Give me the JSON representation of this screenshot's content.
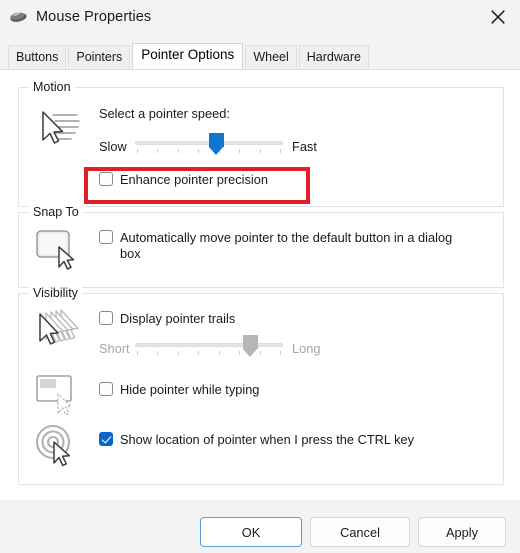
{
  "window": {
    "title": "Mouse Properties",
    "icon": "mouse-icon",
    "close_label": "close-icon"
  },
  "tabs": [
    {
      "label": "Buttons",
      "selected": false
    },
    {
      "label": "Pointers",
      "selected": false
    },
    {
      "label": "Pointer Options",
      "selected": true
    },
    {
      "label": "Wheel",
      "selected": false
    },
    {
      "label": "Hardware",
      "selected": false
    }
  ],
  "groups": {
    "motion": {
      "label": "Motion",
      "icon": "pointer-speed-icon",
      "speed_prompt": "Select a pointer speed:",
      "slider": {
        "min_label": "Slow",
        "max_label": "Fast",
        "value_percent": 55,
        "enabled": true
      },
      "enhance_precision": {
        "label": "Enhance pointer precision",
        "checked": false,
        "highlighted": true
      }
    },
    "snap_to": {
      "label": "Snap To",
      "icon": "default-button-cursor-icon",
      "auto_move": {
        "label": "Automatically move pointer to the default button in a dialog box",
        "checked": false
      }
    },
    "visibility": {
      "label": "Visibility",
      "pointer_trails": {
        "icon": "pointer-trails-icon",
        "label": "Display pointer trails",
        "checked": false,
        "slider": {
          "min_label": "Short",
          "max_label": "Long",
          "value_percent": 78,
          "enabled": false
        }
      },
      "hide_while_typing": {
        "icon": "hide-pointer-typing-icon",
        "label": "Hide pointer while typing",
        "checked": false
      },
      "show_location": {
        "icon": "ctrl-locate-pointer-icon",
        "label": "Show location of pointer when I press the CTRL key",
        "checked": true
      }
    }
  },
  "footer": {
    "ok": "OK",
    "cancel": "Cancel",
    "apply": "Apply"
  },
  "colors": {
    "accent": "#0b64c8",
    "slider_thumb": "#0f76d4",
    "annotation": "#e01f26",
    "default_button_border": "#5b9bd5"
  }
}
